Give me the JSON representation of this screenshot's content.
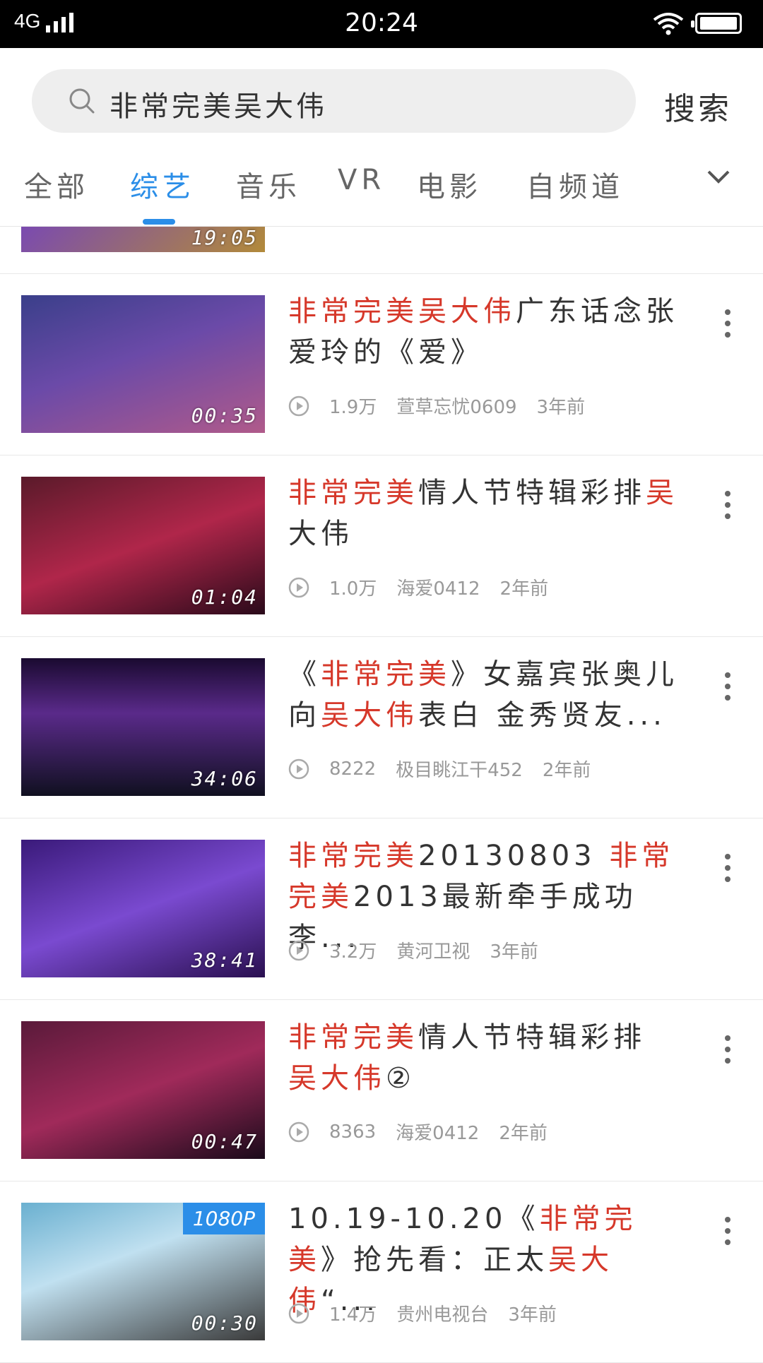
{
  "status_bar": {
    "network": "4G",
    "time": "20:24"
  },
  "search": {
    "query": "非常完美吴大伟",
    "button_label": "搜索"
  },
  "tabs": [
    {
      "label": "全部",
      "active": false
    },
    {
      "label": "综艺",
      "active": true
    },
    {
      "label": "音乐",
      "active": false
    },
    {
      "label": "VR",
      "active": false
    },
    {
      "label": "电影",
      "active": false
    },
    {
      "label": "自频道",
      "active": false
    }
  ],
  "partial_item": {
    "duration": "19:05"
  },
  "results": [
    {
      "title_parts": [
        {
          "text": "非常完美吴大伟",
          "hl": true
        },
        {
          "text": "广东话念张爱玲的《爱》",
          "hl": false
        }
      ],
      "views": "1.9万",
      "uploader": "萱草忘忧0609",
      "age": "3年前",
      "duration": "00:35",
      "badge": ""
    },
    {
      "title_parts": [
        {
          "text": "非常完美",
          "hl": true
        },
        {
          "text": "情人节特辑彩排",
          "hl": false
        },
        {
          "text": "吴",
          "hl": true
        },
        {
          "text": "大伟",
          "hl": false
        }
      ],
      "views": "1.0万",
      "uploader": "海爱0412",
      "age": "2年前",
      "duration": "01:04",
      "badge": ""
    },
    {
      "title_parts": [
        {
          "text": "《",
          "hl": false
        },
        {
          "text": "非常完美",
          "hl": true
        },
        {
          "text": "》女嘉宾张奥儿向",
          "hl": false
        },
        {
          "text": "吴大伟",
          "hl": true
        },
        {
          "text": "表白 金秀贤友...",
          "hl": false
        }
      ],
      "views": "8222",
      "uploader": "极目眺江干452",
      "age": "2年前",
      "duration": "34:06",
      "badge": ""
    },
    {
      "title_parts": [
        {
          "text": "非常完美",
          "hl": true
        },
        {
          "text": "20130803 ",
          "hl": false
        },
        {
          "text": "非常完美",
          "hl": true
        },
        {
          "text": "2013最新牵手成功 李...",
          "hl": false
        }
      ],
      "views": "3.2万",
      "uploader": "黄河卫视",
      "age": "3年前",
      "duration": "38:41",
      "badge": ""
    },
    {
      "title_parts": [
        {
          "text": "非常完美",
          "hl": true
        },
        {
          "text": "情人节特辑彩排 ",
          "hl": false
        },
        {
          "text": "吴大伟",
          "hl": true
        },
        {
          "text": "②",
          "hl": false
        }
      ],
      "views": "8363",
      "uploader": "海爱0412",
      "age": "2年前",
      "duration": "00:47",
      "badge": ""
    },
    {
      "title_parts": [
        {
          "text": "10.19-10.20《",
          "hl": false
        },
        {
          "text": "非常完美",
          "hl": true
        },
        {
          "text": "》抢先看：正太",
          "hl": false
        },
        {
          "text": "吴大伟",
          "hl": true
        },
        {
          "text": "“...",
          "hl": false
        }
      ],
      "views": "1.4万",
      "uploader": "贵州电视台",
      "age": "3年前",
      "duration": "00:30",
      "badge": "1080P"
    }
  ],
  "colors": {
    "accent": "#2b8ee8",
    "highlight": "#d6382a"
  },
  "icons": {
    "search": "search-icon",
    "play": "play-count-icon",
    "more": "more-vertical-icon",
    "dropdown": "chevron-down-icon"
  }
}
